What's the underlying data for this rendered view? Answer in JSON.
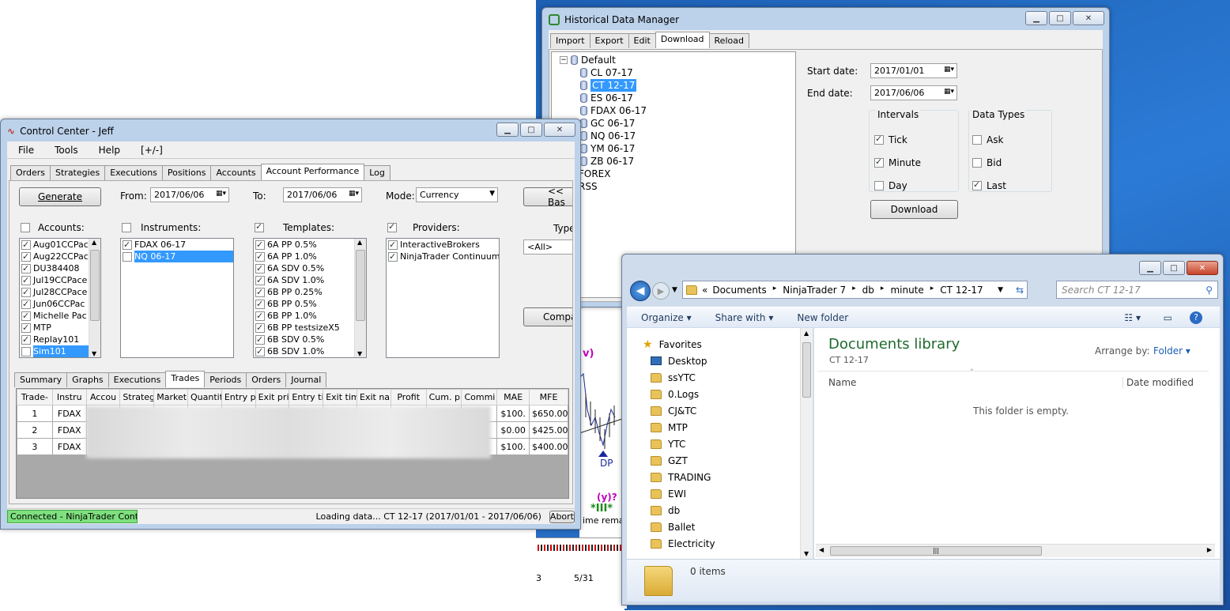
{
  "historical": {
    "title": "Historical Data Manager",
    "tabs": [
      "Import",
      "Export",
      "Edit",
      "Download",
      "Reload"
    ],
    "tree": {
      "root": "Default",
      "items": [
        "CL 07-17",
        "CT 12-17",
        "ES 06-17",
        "FDAX 06-17",
        "GC 06-17",
        "NQ 06-17",
        "YM 06-17",
        "ZB 06-17"
      ],
      "selected_index": 1,
      "other": [
        "FOREX",
        "RSS"
      ]
    },
    "start_label": "Start date:",
    "start_value": "2017/01/01",
    "end_label": "End date:",
    "end_value": "2017/06/06",
    "intervals_label": "Intervals",
    "intervals": [
      {
        "label": "Tick",
        "checked": true
      },
      {
        "label": "Minute",
        "checked": true
      },
      {
        "label": "Day",
        "checked": false
      }
    ],
    "types_label": "Data Types",
    "types": [
      {
        "label": "Ask",
        "checked": false
      },
      {
        "label": "Bid",
        "checked": false
      },
      {
        "label": "Last",
        "checked": true
      }
    ],
    "download_btn": "Download"
  },
  "control": {
    "title": "Control Center - Jeff",
    "menu": [
      "File",
      "Tools",
      "Help",
      "[+/-]"
    ],
    "tabs": [
      "Orders",
      "Strategies",
      "Executions",
      "Positions",
      "Accounts",
      "Account Performance",
      "Log"
    ],
    "generate": "Generate",
    "from_label": "From:",
    "from_value": "2017/06/06",
    "to_label": "To:",
    "to_value": "2017/06/06",
    "mode_label": "Mode:",
    "mode_value": "Currency",
    "back_btn": "<< Bas",
    "accounts_label": "Accounts:",
    "instruments_label": "Instruments:",
    "templates_label": "Templates:",
    "providers_label": "Providers:",
    "type_label": "Type",
    "type_value": "<All>",
    "compare_btn": "Compa",
    "accounts": [
      {
        "t": "Aug01CCPac",
        "c": true
      },
      {
        "t": "Aug22CCPac",
        "c": true
      },
      {
        "t": "DU384408",
        "c": true
      },
      {
        "t": "Jul19CCPace",
        "c": true
      },
      {
        "t": "Jul28CCPace",
        "c": true
      },
      {
        "t": "Jun06CCPac",
        "c": true
      },
      {
        "t": "Michelle Pac",
        "c": true
      },
      {
        "t": "MTP",
        "c": true
      },
      {
        "t": "Replay101",
        "c": true
      },
      {
        "t": "Sim101",
        "c": false,
        "sel": true
      }
    ],
    "instruments": [
      {
        "t": "FDAX 06-17",
        "c": true
      },
      {
        "t": "NQ 06-17",
        "c": false,
        "sel": true
      }
    ],
    "templates": [
      {
        "t": "6A PP 0.5%",
        "c": true
      },
      {
        "t": "6A PP 1.0%",
        "c": true
      },
      {
        "t": "6A SDV 0.5%",
        "c": true
      },
      {
        "t": "6A SDV 1.0%",
        "c": true
      },
      {
        "t": "6B PP 0.25%",
        "c": true
      },
      {
        "t": "6B PP 0.5%",
        "c": true
      },
      {
        "t": "6B PP 1.0%",
        "c": true
      },
      {
        "t": "6B PP testsizeX5",
        "c": true
      },
      {
        "t": "6B SDV 0.5%",
        "c": true
      },
      {
        "t": "6B SDV 1.0%",
        "c": true
      }
    ],
    "providers": [
      {
        "t": "InteractiveBrokers",
        "c": true
      },
      {
        "t": "NinjaTrader Continuum",
        "c": true
      }
    ],
    "subtabs": [
      "Summary",
      "Graphs",
      "Executions",
      "Trades",
      "Periods",
      "Orders",
      "Journal"
    ],
    "columns": [
      "Trade-",
      "Instru",
      "Accou",
      "Strateg",
      "Market",
      "Quantit",
      "Entry p",
      "Exit pri",
      "Entry ti",
      "Exit tim",
      "Exit na",
      "Profit",
      "Cum. p",
      "Commi",
      "MAE",
      "MFE"
    ],
    "rows": [
      [
        "1",
        "FDAX",
        "$100.",
        "$650.00"
      ],
      [
        "2",
        "FDAX",
        "$0.00",
        "$425.00"
      ],
      [
        "3",
        "FDAX",
        "$100.",
        "$400.00"
      ]
    ],
    "status_connected": "Connected - NinjaTrader Continuum",
    "status_loading": "Loading data... CT 12-17  (2017/01/01 - 2017/06/06)",
    "abort": "Abort"
  },
  "chart": {
    "dp_label": "DP",
    "v_label": "v)",
    "yq_label": "(y)?",
    "iii_label": "*III*",
    "time_text": "ime rema",
    "date_label": "5/31",
    "left_num": "3"
  },
  "explorer": {
    "breadcrumb": [
      "Documents",
      "NinjaTrader 7",
      "db",
      "minute",
      "CT 12-17"
    ],
    "search_placeholder": "Search CT 12-17",
    "toolbar": {
      "organize": "Organize",
      "share": "Share with",
      "new_folder": "New folder"
    },
    "favorites_label": "Favorites",
    "nav": [
      "Desktop",
      "ssYTC",
      "0.Logs",
      "CJ&TC",
      "MTP",
      "YTC",
      "GZT",
      "TRADING",
      "EWI",
      "db",
      "Ballet",
      "Electricity"
    ],
    "lib_title": "Documents library",
    "lib_sub": "CT 12-17",
    "arrange_label": "Arrange by:",
    "arrange_value": "Folder",
    "col_name": "Name",
    "col_date": "Date modified",
    "empty_msg": "This folder is empty.",
    "items_count": "0 items"
  }
}
